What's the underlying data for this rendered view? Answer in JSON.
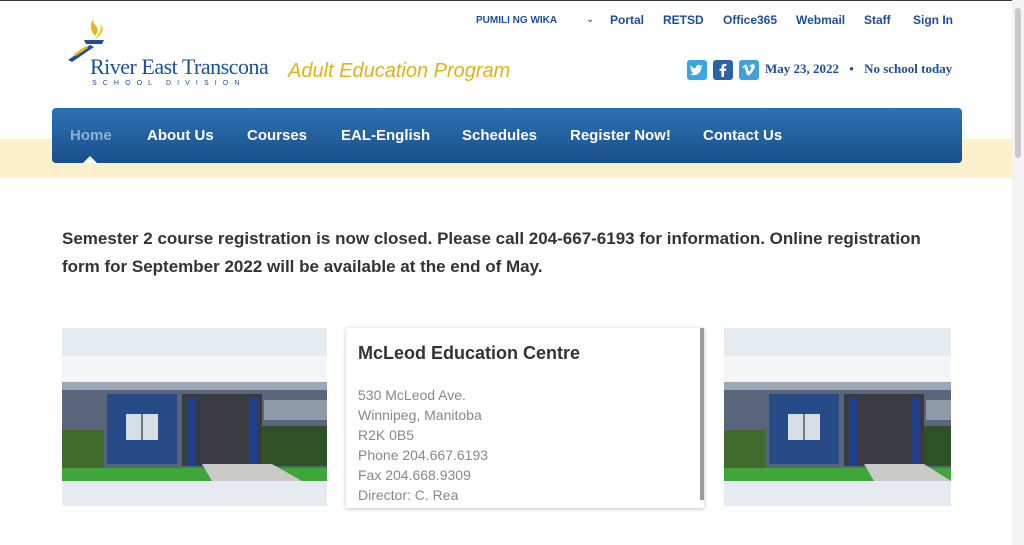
{
  "header": {
    "logo": {
      "name": "River East Transcona",
      "subtitle": "SCHOOL DIVISION"
    },
    "program_title": "Adult Education Program",
    "language_select": "PUMILI NG WIKA",
    "top_links": [
      "Portal",
      "RETSD",
      "Office365",
      "Webmail",
      "Staff",
      "Sign In"
    ],
    "social_icons": [
      "twitter-icon",
      "facebook-icon",
      "vimeo-icon"
    ],
    "date": "May 23, 2022",
    "separator": "•",
    "status": "No school today"
  },
  "nav": {
    "items": [
      "Home",
      "About Us",
      "Courses",
      "EAL-English",
      "Schedules",
      "Register Now!",
      "Contact Us"
    ],
    "active": "Home"
  },
  "notice": {
    "text": "Semester 2 course registration is now closed.  Please call 204-667-6193 for information.  Online registration form for September 2022 will be available at the end of May."
  },
  "location": {
    "title": "McLeod Education Centre",
    "address_line1": "530 McLeod Ave.",
    "address_line2": "Winnipeg, Manitoba",
    "postal_code": "R2K 0B5",
    "phone": "Phone 204.667.6193",
    "fax": "Fax 204.668.9309",
    "director": "Director: C. Rea"
  },
  "colors": {
    "brand_blue": "#1c4f96",
    "nav_blue": "#1f5c9c",
    "program_gold": "#e0b21a",
    "nav_band": "#fcf0cd",
    "twitter": "#3aa6e0",
    "facebook": "#2d62a6",
    "vimeo": "#3fa3d9"
  }
}
